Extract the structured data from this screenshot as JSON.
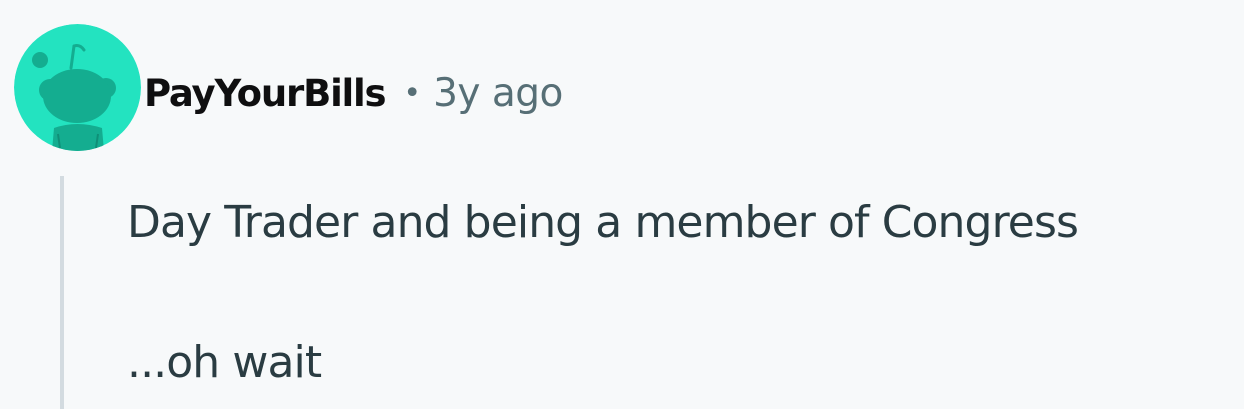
{
  "comment": {
    "author": "PayYourBills",
    "separator": "•",
    "timestamp": "3y ago",
    "avatar_icon": "reddit-snoo-avatar-icon",
    "body": {
      "paragraphs": [
        "Day Trader and being a member of Congress",
        "...oh wait"
      ]
    }
  },
  "colors": {
    "background": "#f7f9fa",
    "avatar_bg": "#23e3c0",
    "avatar_figure": "#14ad90",
    "username": "#0f0f10",
    "meta_text": "#576f76",
    "body_text": "#2a3c42",
    "thread_line": "#d3dbe0"
  }
}
